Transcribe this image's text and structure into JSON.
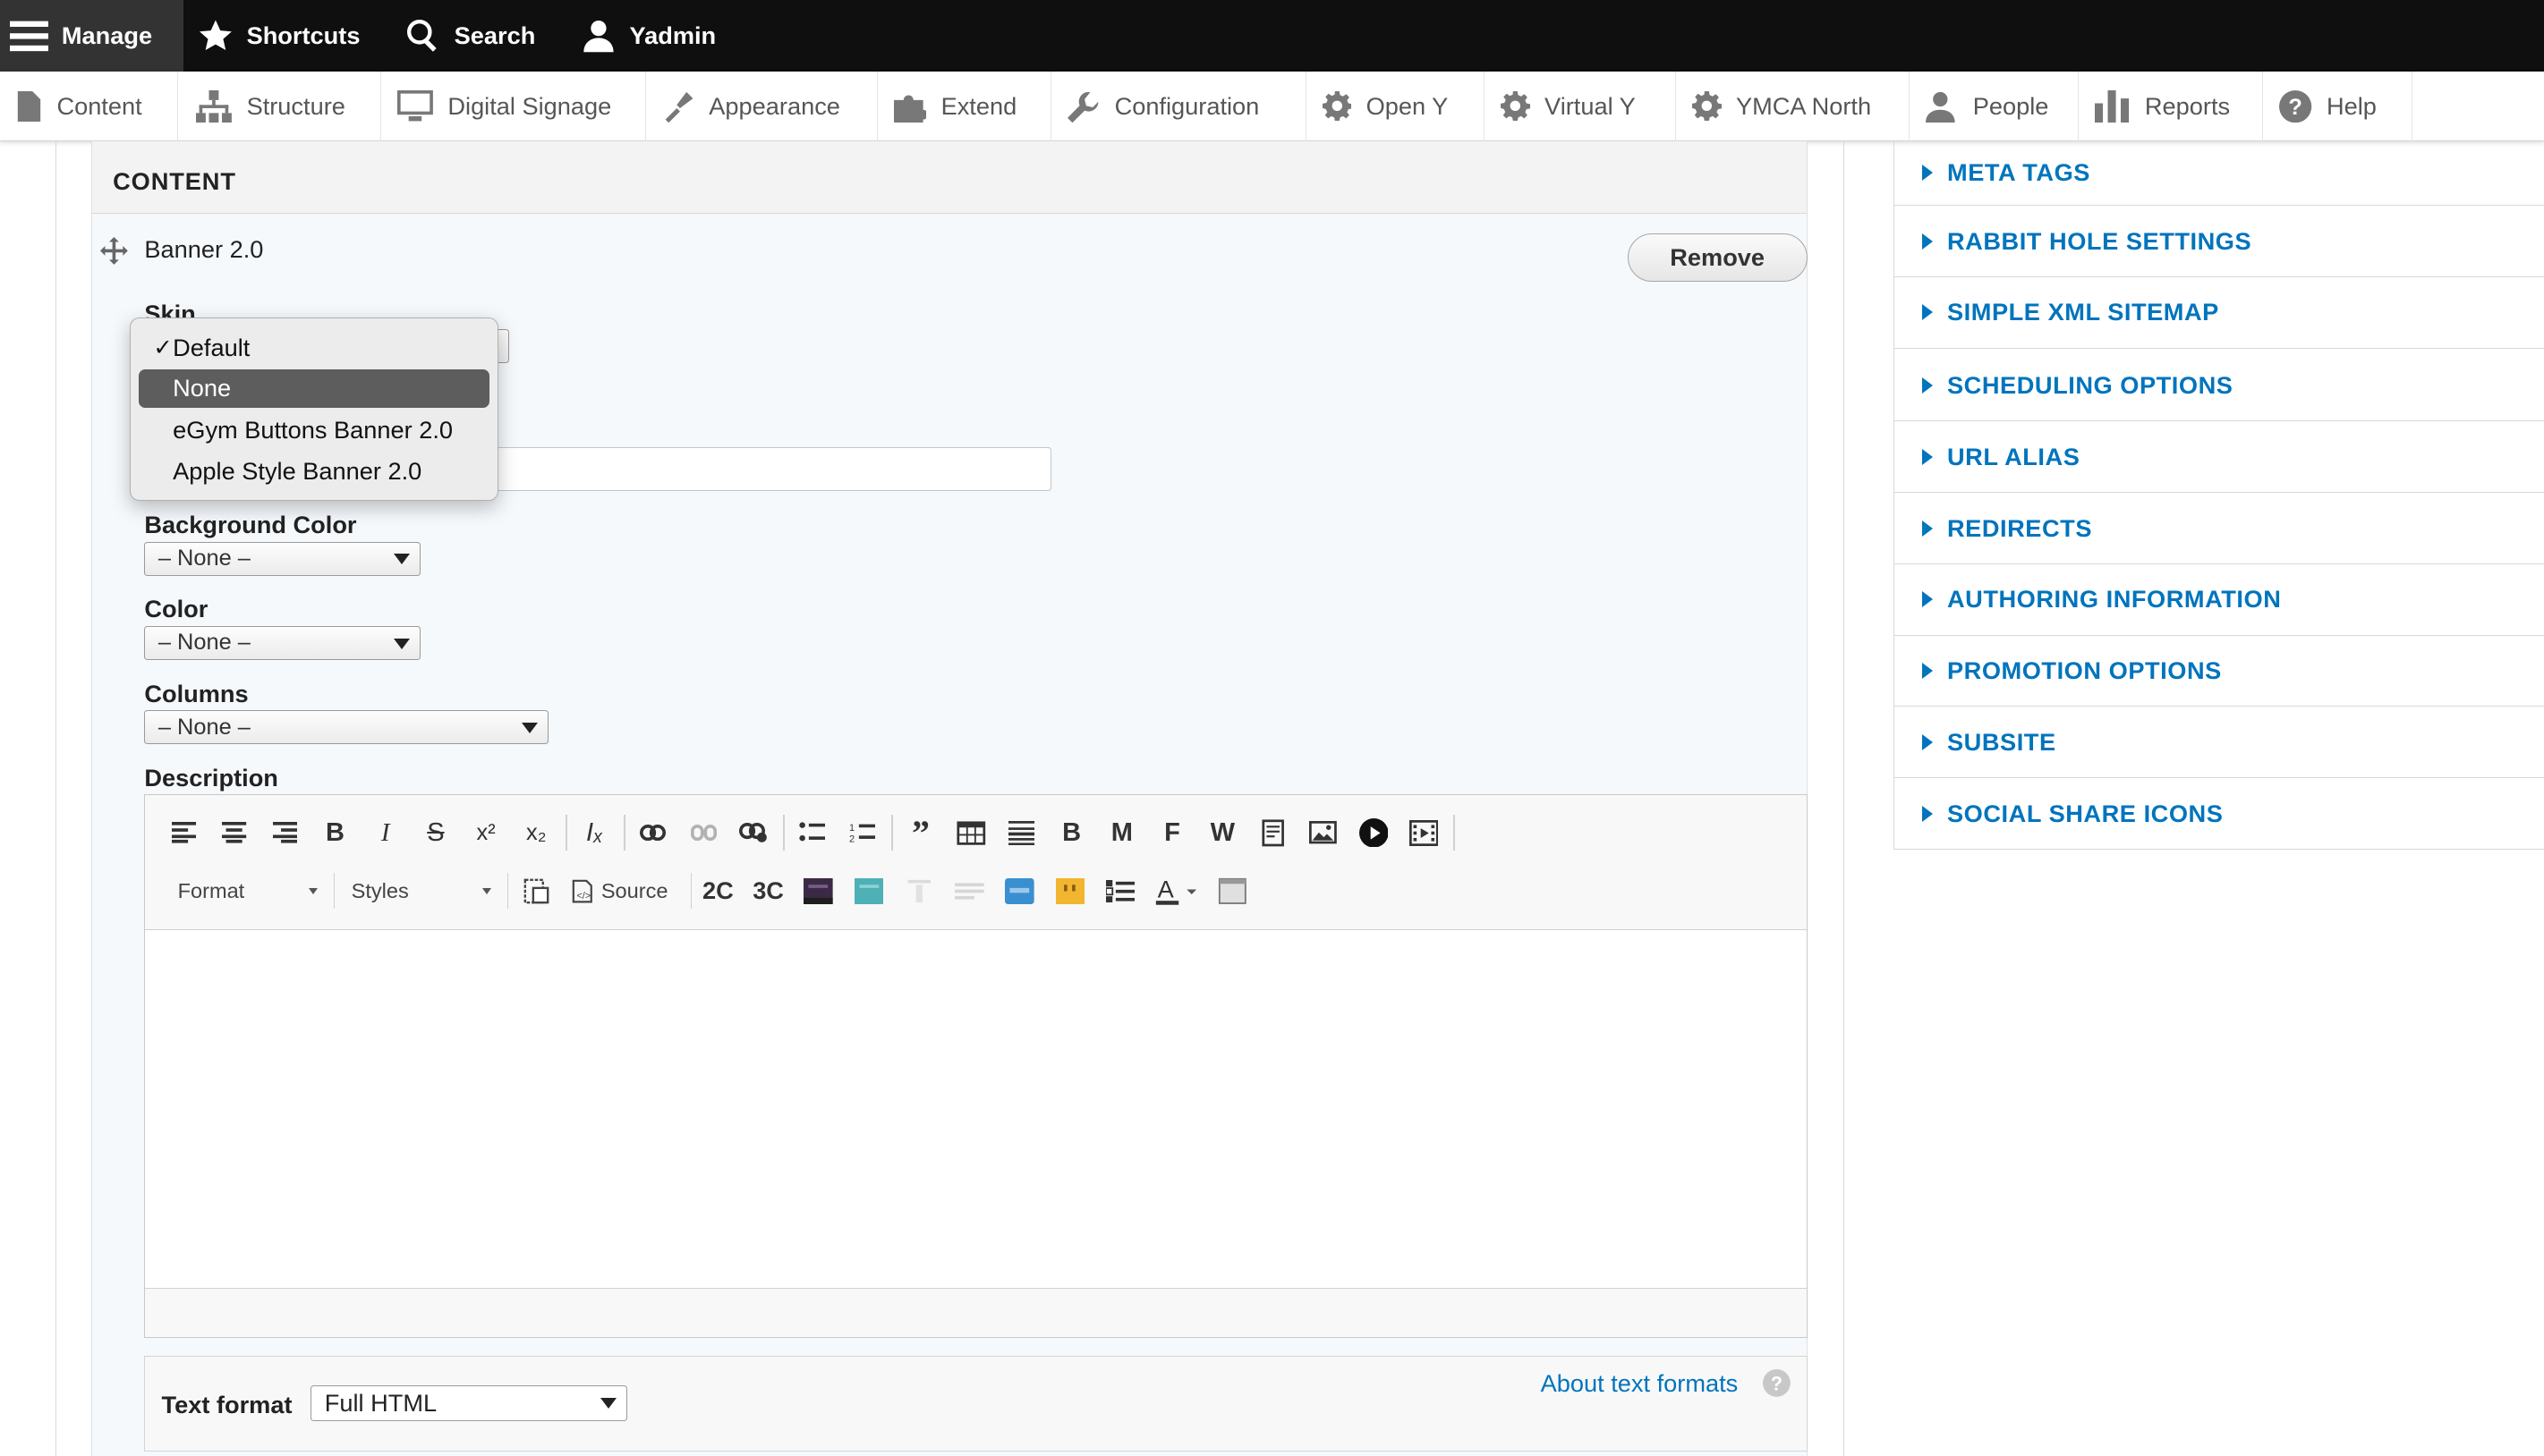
{
  "toolbar": {
    "manage": "Manage",
    "shortcuts": "Shortcuts",
    "search": "Search",
    "user": "Yadmin"
  },
  "tray": {
    "items": [
      {
        "label": "Content",
        "icon": "file-icon"
      },
      {
        "label": "Structure",
        "icon": "sitemap-icon"
      },
      {
        "label": "Digital Signage",
        "icon": "monitor-icon"
      },
      {
        "label": "Appearance",
        "icon": "brush-icon"
      },
      {
        "label": "Extend",
        "icon": "puzzle-icon"
      },
      {
        "label": "Configuration",
        "icon": "wrench-icon"
      },
      {
        "label": "Open Y",
        "icon": "gear-icon"
      },
      {
        "label": "Virtual Y",
        "icon": "gear-icon"
      },
      {
        "label": "YMCA North",
        "icon": "gear-icon"
      },
      {
        "label": "People",
        "icon": "person-icon"
      },
      {
        "label": "Reports",
        "icon": "bar-chart-icon"
      },
      {
        "label": "Help",
        "icon": "help-icon"
      }
    ]
  },
  "content": {
    "section_title": "CONTENT",
    "paragraph_title": "Banner 2.0",
    "remove_label": "Remove",
    "skin_label": "Skin",
    "skin_options": [
      "Default",
      "None",
      "eGym Buttons Banner 2.0",
      "Apple Style Banner 2.0"
    ],
    "skin_checked": "Default",
    "skin_highlighted": "None",
    "background_color_label": "Background Color",
    "background_color_value": "– None –",
    "color_label": "Color",
    "color_value": "– None –",
    "columns_label": "Columns",
    "columns_value": "– None –",
    "description_label": "Description",
    "format_combo": "Format",
    "styles_combo": "Styles",
    "source_label": "Source",
    "text_format_label": "Text format",
    "text_format_value": "Full HTML",
    "about_text_formats": "About text formats"
  },
  "sidebar": {
    "items": [
      "META TAGS",
      "RABBIT HOLE SETTINGS",
      "SIMPLE XML SITEMAP",
      "SCHEDULING OPTIONS",
      "URL ALIAS",
      "REDIRECTS",
      "AUTHORING INFORMATION",
      "PROMOTION OPTIONS",
      "SUBSITE",
      "SOCIAL SHARE ICONS"
    ]
  },
  "colors": {
    "toolbar_bg": "#0f0f0f",
    "link_blue": "#0074bd",
    "dropdown_highlight": "#5d5d5d"
  }
}
